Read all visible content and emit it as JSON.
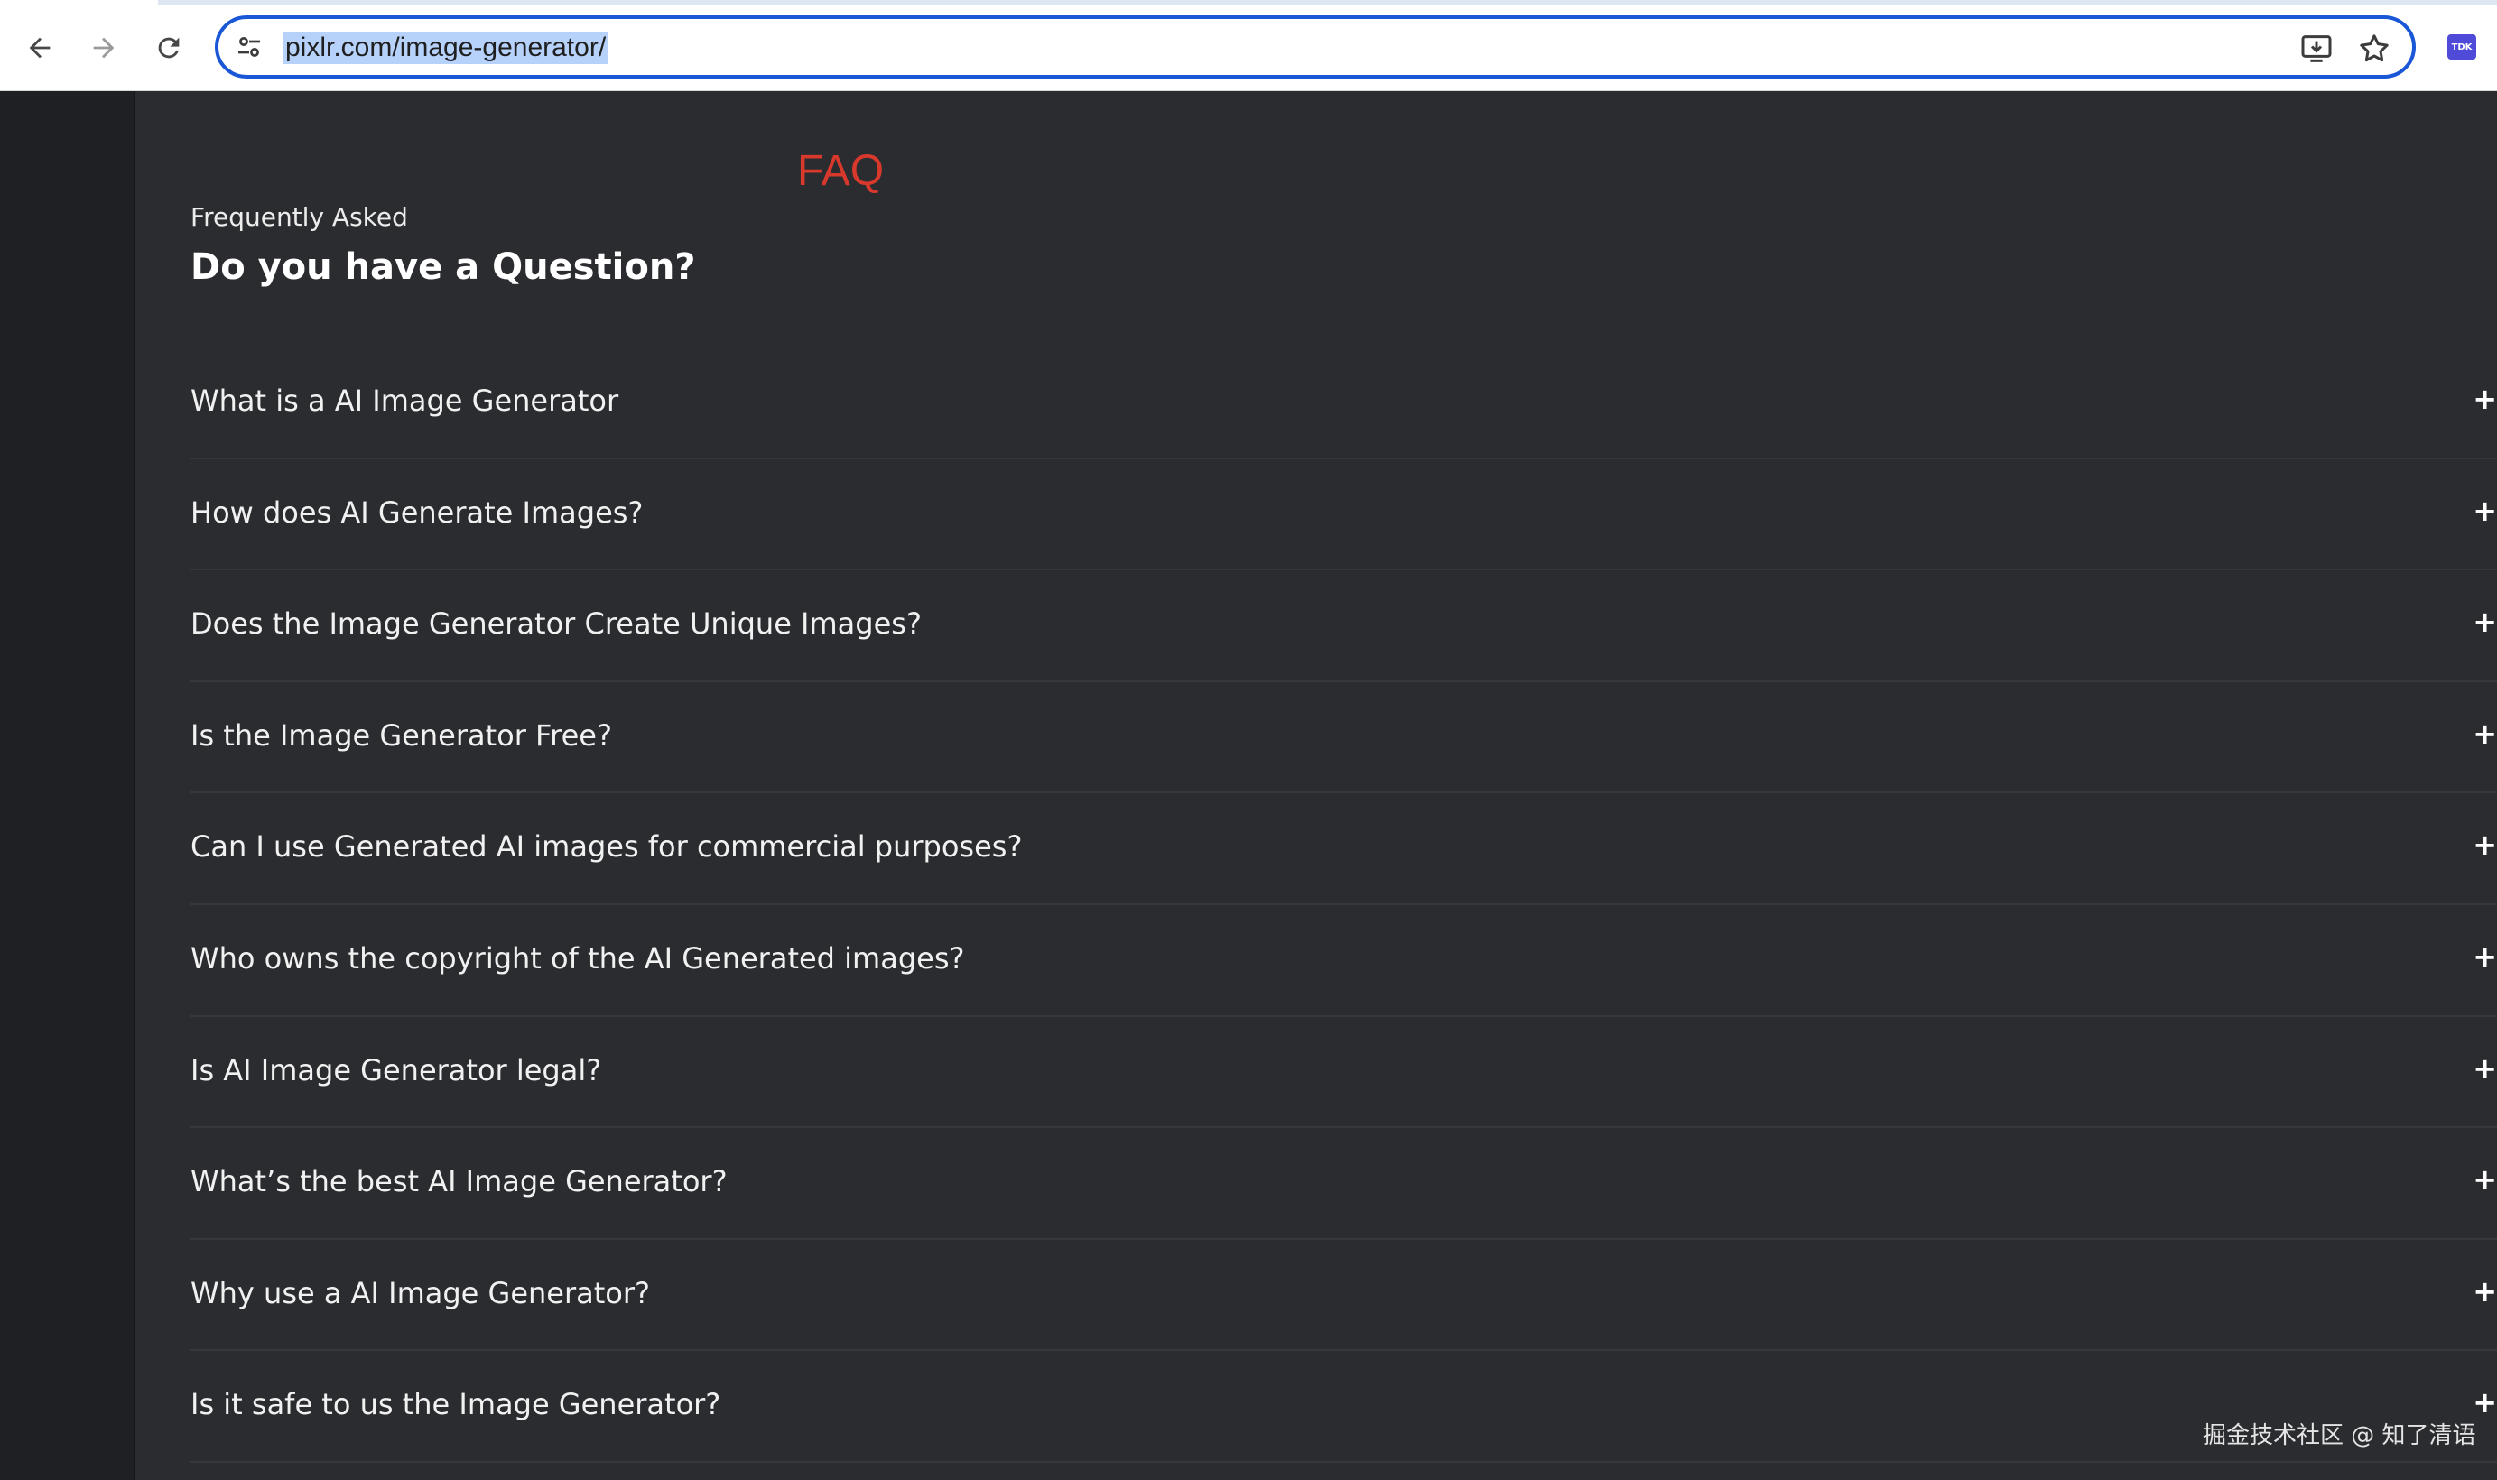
{
  "browser": {
    "url": "pixlr.com/image-generator/",
    "extension_badge": "TDK",
    "icons": {
      "back": "arrow-left-icon",
      "forward": "arrow-right-icon",
      "reload": "reload-icon",
      "site_info": "tune-icon",
      "install": "install-app-icon",
      "bookmark": "star-icon"
    }
  },
  "annotation": {
    "label": "FAQ",
    "color": "#d8392c"
  },
  "faq": {
    "eyebrow": "Frequently Asked",
    "title": "Do you have a Question?",
    "expand_symbol": "+",
    "items": [
      {
        "question": "What is a AI Image Generator"
      },
      {
        "question": "How does AI Generate Images?"
      },
      {
        "question": "Does the Image Generator Create Unique Images?"
      },
      {
        "question": "Is the Image Generator Free?"
      },
      {
        "question": "Can I use Generated AI images for commercial purposes?"
      },
      {
        "question": "Who owns the copyright of the AI Generated images?"
      },
      {
        "question": "Is AI Image Generator legal?"
      },
      {
        "question": "What’s the best AI Image Generator?"
      },
      {
        "question": "Why use a AI Image Generator?"
      },
      {
        "question": "Is it safe to us the Image Generator?"
      }
    ]
  },
  "watermark": "掘金技术社区 @ 知了清语",
  "colors": {
    "page_background": "#2b2c30",
    "rail_background": "#1e2023",
    "omnibox_border": "#1a57d6",
    "url_selection": "#b6d2fb"
  }
}
